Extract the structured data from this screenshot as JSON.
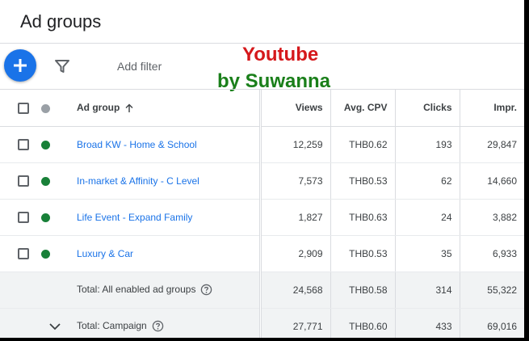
{
  "page": {
    "title": "Ad groups"
  },
  "toolbar": {
    "add_filter": "Add filter"
  },
  "watermark": {
    "line1": "Youtube",
    "line2": "by Suwanna"
  },
  "table": {
    "headers": {
      "ad_group": "Ad group",
      "views": "Views",
      "avg_cpv": "Avg. CPV",
      "clicks": "Clicks",
      "impr": "Impr."
    },
    "rows": [
      {
        "name": "Broad KW - Home & School",
        "views": "12,259",
        "avg_cpv": "THB0.62",
        "clicks": "193",
        "impr": "29,847",
        "status": "enabled"
      },
      {
        "name": "In-market & Affinity - C Level",
        "views": "7,573",
        "avg_cpv": "THB0.53",
        "clicks": "62",
        "impr": "14,660",
        "status": "enabled"
      },
      {
        "name": "Life Event - Expand Family",
        "views": "1,827",
        "avg_cpv": "THB0.63",
        "clicks": "24",
        "impr": "3,882",
        "status": "enabled"
      },
      {
        "name": "Luxury & Car",
        "views": "2,909",
        "avg_cpv": "THB0.53",
        "clicks": "35",
        "impr": "6,933",
        "status": "enabled"
      }
    ],
    "totals": [
      {
        "label": "Total: All enabled ad groups",
        "views": "24,568",
        "avg_cpv": "THB0.58",
        "clicks": "314",
        "impr": "55,322"
      },
      {
        "label": "Total: Campaign",
        "views": "27,771",
        "avg_cpv": "THB0.60",
        "clicks": "433",
        "impr": "69,016"
      }
    ]
  },
  "colors": {
    "accent": "#1a73e8",
    "enabled": "#188038",
    "watermark_red": "#d5181b",
    "watermark_green": "#1a7f1a"
  },
  "icons": [
    "add-icon",
    "filter-icon",
    "sort-arrow-up-icon",
    "help-icon",
    "chevron-down-icon"
  ]
}
